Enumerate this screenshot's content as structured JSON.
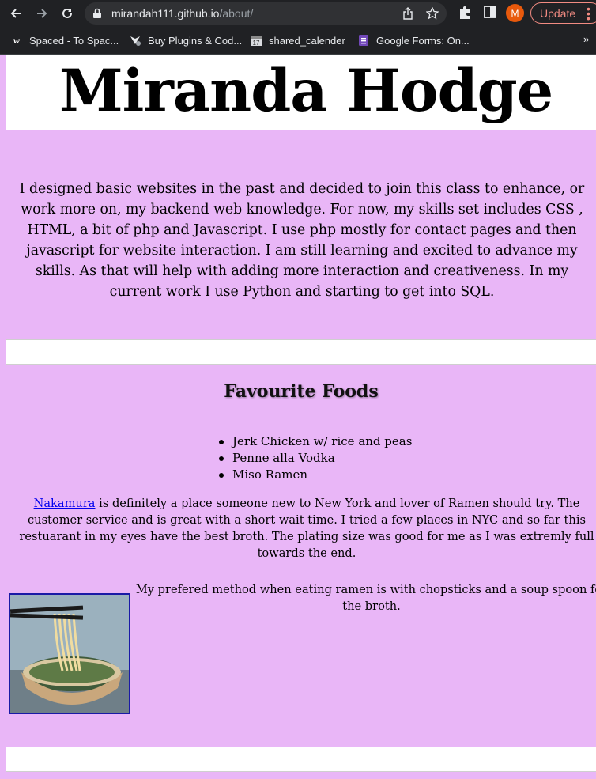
{
  "browser": {
    "url_host": "mirandah111.github.io",
    "url_path": "/about/",
    "avatar_letter": "M",
    "update_label": "Update",
    "more_bookmarks": "»",
    "bookmarks": [
      {
        "label": "Spaced - To Spac...",
        "icon": "w-icon"
      },
      {
        "label": "Buy Plugins & Cod...",
        "icon": "plugin-icon"
      },
      {
        "label": "shared_calender",
        "icon": "calendar-icon"
      },
      {
        "label": "Google Forms: On...",
        "icon": "forms-icon"
      }
    ]
  },
  "page": {
    "title": "Miranda Hodge",
    "intro": "I designed basic websites in the past and decided to join this class to enhance, or work more on, my backend web knowledge. For now, my skills set includes CSS , HTML, a bit of php and Javascript. I use php mostly for contact pages and then javascript for website interaction. I am still learning and excited to advance my skills. As that will help with adding more interaction and creativeness. In my current work I use Python and starting to get into SQL.",
    "foods_heading": "Favourite Foods",
    "foods": [
      "Jerk Chicken w/ rice and peas",
      "Penne alla Vodka",
      "Miso Ramen"
    ],
    "review_link": "Nakamura",
    "review_text": " is definitely a place someone new to New York and lover of Ramen should try. The customer service and is great with a short wait time. I tried a few places in NYC and so far this restuarant in my eyes have the best broth. The plating size was good for me as I was extremly full towards the end.",
    "method_text": "My prefered method when eating ramen is with chopsticks and a soup spoon for the broth."
  },
  "colors": {
    "page_background": "#e9b6f7",
    "chrome_dark": "#202124",
    "link": "#0000ee",
    "update_accent": "#f28b82",
    "avatar": "#e8590c"
  }
}
